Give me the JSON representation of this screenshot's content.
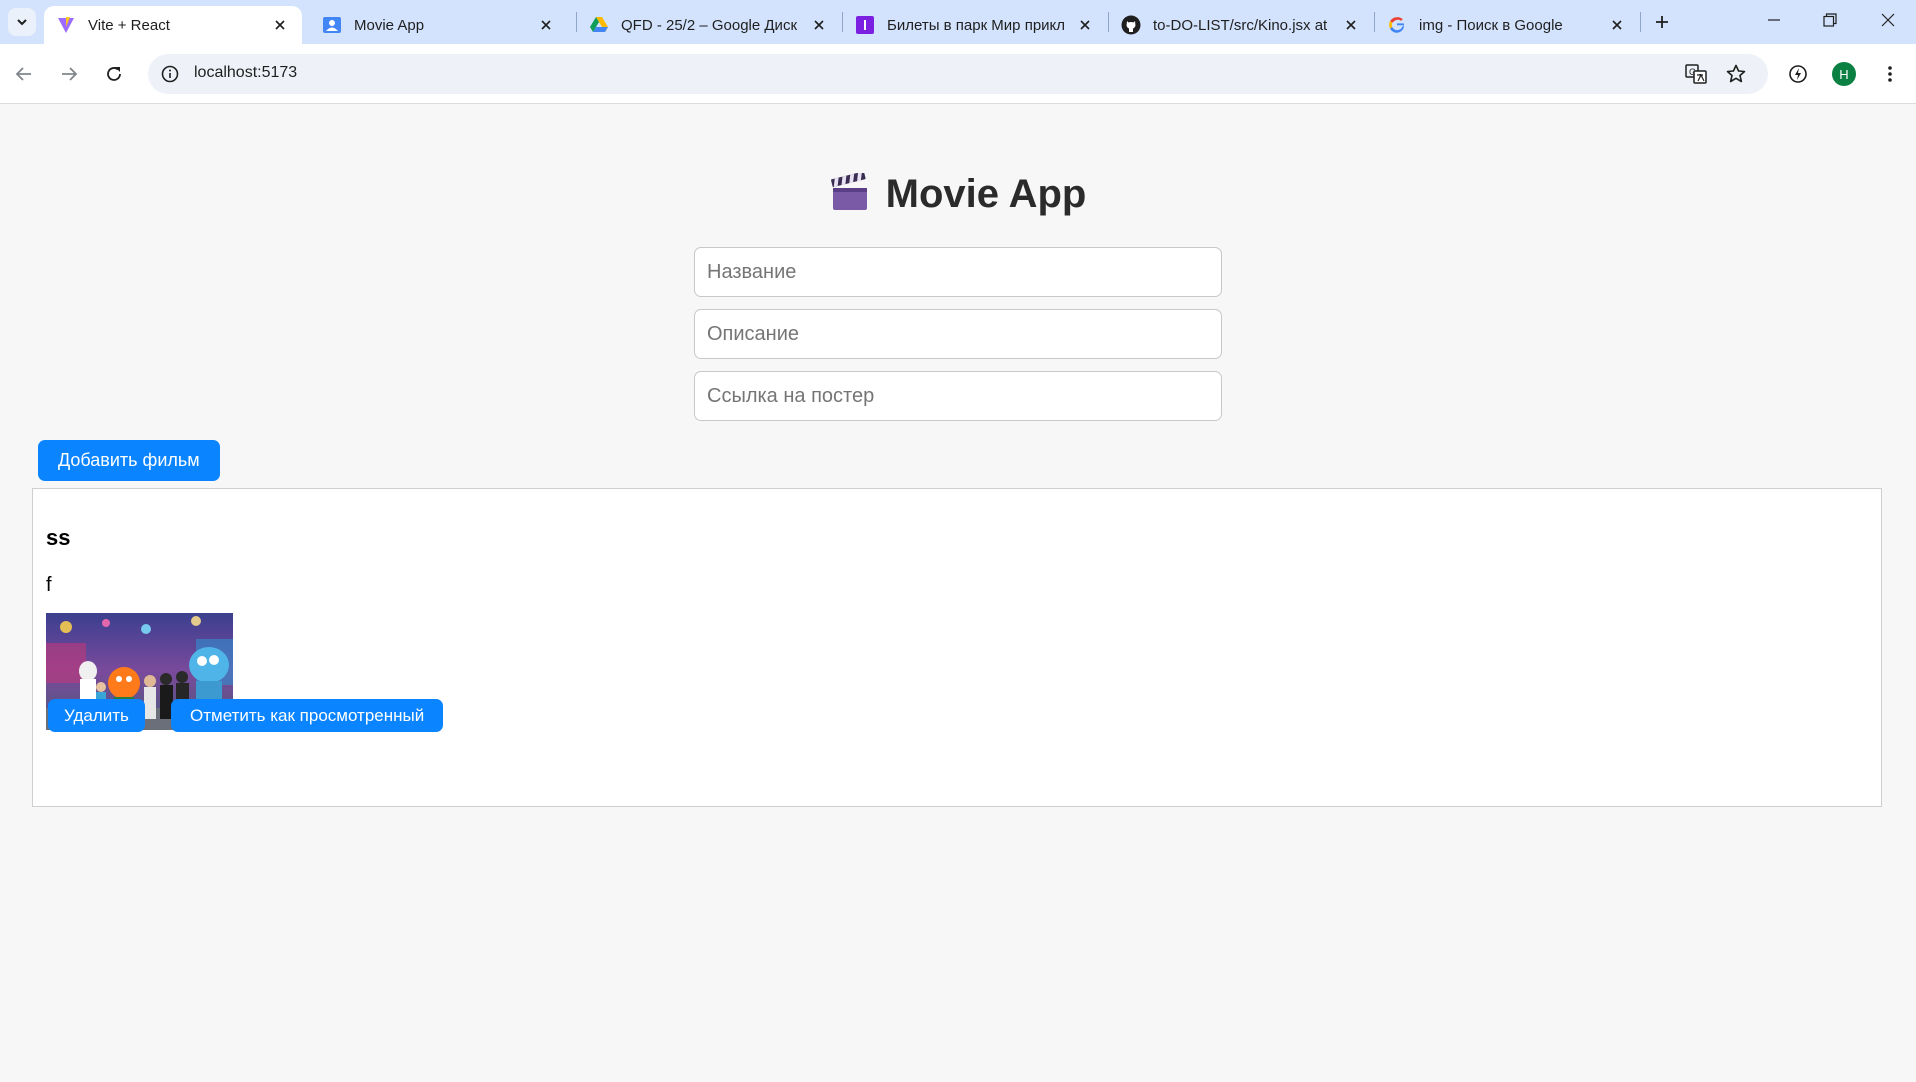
{
  "browser": {
    "tabs": [
      {
        "title": "Vite + React",
        "favicon": "vite-icon",
        "active": true
      },
      {
        "title": "Movie App",
        "favicon": "contact-card-icon",
        "active": false
      },
      {
        "title": "QFD - 25/2 – Google Диск",
        "favicon": "google-drive-icon",
        "active": false
      },
      {
        "title": "Билеты в парк Мир прикл",
        "favicon": "purple-i-icon",
        "active": false
      },
      {
        "title": "to-DO-LIST/src/Kino.jsx at",
        "favicon": "github-icon",
        "active": false
      },
      {
        "title": "img - Поиск в Google",
        "favicon": "google-icon",
        "active": false
      }
    ],
    "url": "localhost:5173",
    "profile_initial": "H",
    "colors": {
      "tabbar": "#d3e3fd",
      "profile": "#0b8043"
    }
  },
  "app": {
    "title": "Movie App",
    "title_icon": "clapperboard-icon",
    "form": {
      "title_placeholder": "Название",
      "description_placeholder": "Описание",
      "poster_placeholder": "Ссылка на постер",
      "add_button": "Добавить фильм"
    },
    "movies": [
      {
        "title": "ss",
        "description": "f",
        "poster": "amusement-park-photo",
        "delete_button": "Удалить",
        "watched_button": "Отметить как просмотренный"
      }
    ],
    "colors": {
      "accent": "#0a84ff",
      "background": "#f7f7f7",
      "card_border": "#cfcfcf"
    }
  }
}
